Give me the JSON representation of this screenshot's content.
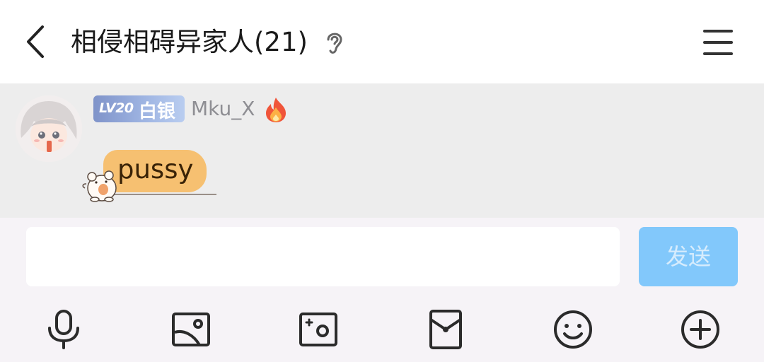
{
  "header": {
    "title": "相侵相碍异家人(21)",
    "back_icon": "chevron-left-icon",
    "listen_icon": "ear-icon",
    "menu_icon": "hamburger-menu-icon"
  },
  "message": {
    "level": "LV20",
    "rank": "白银",
    "username": "Mku_X",
    "text": "pussy",
    "bubble_color": "#f6c071",
    "level_badge_color": "#8fa4d8"
  },
  "composer": {
    "input_value": "",
    "send_label": "发送",
    "send_color": "#82c8fb"
  },
  "toolbar": [
    "microphone-icon",
    "image-icon",
    "camera-icon",
    "red-packet-icon",
    "emoji-icon",
    "plus-icon"
  ]
}
